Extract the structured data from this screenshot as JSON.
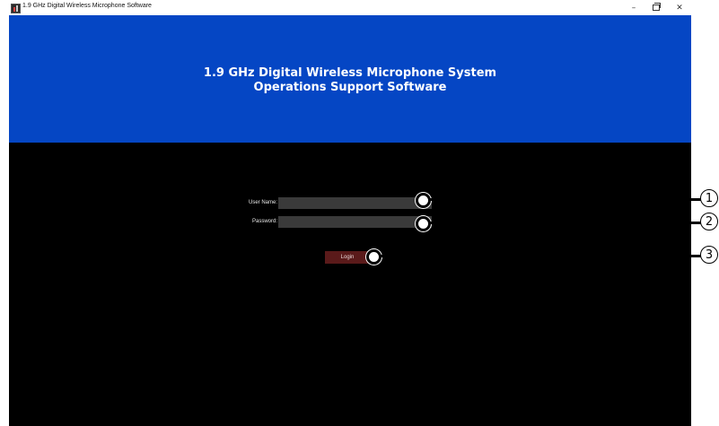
{
  "window": {
    "title": "1.9 GHz Digital Wireless Microphone Software",
    "controls": {
      "minimize": "–",
      "close": "✕"
    }
  },
  "banner": {
    "line1": "1.9 GHz Digital Wireless Microphone System",
    "line2": "Operations Support Software",
    "background_color": "#0546c4"
  },
  "login_form": {
    "username_label": "User Name:",
    "username_value": "",
    "password_label": "Password:",
    "password_value": "",
    "login_button": "Login"
  },
  "callouts": [
    "1",
    "2",
    "3"
  ],
  "colors": {
    "app_background": "#000000",
    "field_background": "#3a3a3a",
    "button_background": "#5a1a1a"
  }
}
